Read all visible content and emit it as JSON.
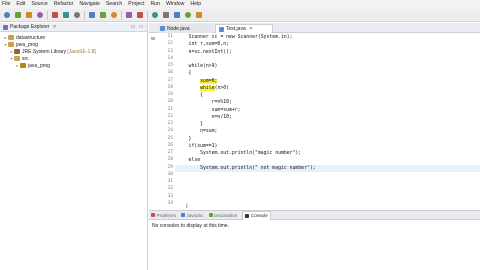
{
  "menubar": {
    "items": [
      {
        "label": "File"
      },
      {
        "label": "Edit"
      },
      {
        "label": "Source"
      },
      {
        "label": "Refactor"
      },
      {
        "label": "Navigate"
      },
      {
        "label": "Search"
      },
      {
        "label": "Project"
      },
      {
        "label": "Run"
      },
      {
        "label": "Window"
      },
      {
        "label": "Help"
      }
    ]
  },
  "toolbar": {
    "icons": [
      "new-file",
      "save",
      "save-all",
      "print",
      "separator",
      "debug",
      "run",
      "external-tools",
      "separator",
      "new-java-project",
      "new-package",
      "new-class",
      "separator",
      "open-type",
      "search",
      "separator",
      "toggle-mark",
      "next-annotation",
      "prev-annotation",
      "back",
      "forward"
    ]
  },
  "explorer": {
    "title": "Package Explorer",
    "tree": [
      {
        "label": "datastructure",
        "suffix": "",
        "icon": "project-icon",
        "indent": 0,
        "expanded": false
      },
      {
        "label": "java_prog",
        "suffix": "",
        "icon": "project-icon",
        "indent": 0,
        "expanded": true
      },
      {
        "label": "JRE System Library",
        "suffix": "[JavaSE-1.8]",
        "icon": "library-icon",
        "indent": 1,
        "expanded": false
      },
      {
        "label": "src",
        "suffix": "",
        "icon": "source-folder-icon",
        "indent": 1,
        "expanded": true
      },
      {
        "label": "java_prog",
        "suffix": "",
        "icon": "package-icon",
        "indent": 2,
        "expanded": false
      }
    ]
  },
  "editor": {
    "tabs": [
      {
        "label": "Node.java",
        "active": false
      },
      {
        "label": "Test.java",
        "active": true
      }
    ],
    "lines": [
      {
        "no": "11",
        "segments": [
          {
            "text": "    Scanner sc = new Scanner(System.in);",
            "hl": false
          }
        ]
      },
      {
        "no": "12",
        "segments": [
          {
            "text": "    int r,sum=0,n;",
            "hl": false
          }
        ]
      },
      {
        "no": "13",
        "segments": [
          {
            "text": "    n=sc.nextInt();",
            "hl": false
          }
        ]
      },
      {
        "no": "14",
        "segments": [
          {
            "text": "",
            "hl": false
          }
        ]
      },
      {
        "no": "15",
        "segments": [
          {
            "text": "    while(n>9)",
            "hl": false
          }
        ]
      },
      {
        "no": "16",
        "segments": [
          {
            "text": "    {",
            "hl": false
          }
        ]
      },
      {
        "no": "17",
        "segments": [
          {
            "text": "        ",
            "hl": false
          },
          {
            "text": "sum=0;",
            "hl": true
          }
        ]
      },
      {
        "no": "18",
        "segments": [
          {
            "text": "        ",
            "hl": false
          },
          {
            "text": "while",
            "hl": true
          },
          {
            "text": "(n>0)",
            "hl": false
          }
        ]
      },
      {
        "no": "19",
        "segments": [
          {
            "text": "        {",
            "hl": false
          }
        ]
      },
      {
        "no": "20",
        "segments": [
          {
            "text": "            r=n%10;",
            "hl": false
          }
        ]
      },
      {
        "no": "21",
        "segments": [
          {
            "text": "            sum=sum+r;",
            "hl": false
          }
        ]
      },
      {
        "no": "22",
        "segments": [
          {
            "text": "            n=n/10;",
            "hl": false
          }
        ]
      },
      {
        "no": "23",
        "segments": [
          {
            "text": "        }",
            "hl": false
          }
        ]
      },
      {
        "no": "24",
        "segments": [
          {
            "text": "        n=sum;",
            "hl": false
          }
        ]
      },
      {
        "no": "25",
        "segments": [
          {
            "text": "    }",
            "hl": false
          }
        ]
      },
      {
        "no": "26",
        "segments": [
          {
            "text": "    if(sum==1)",
            "hl": false
          }
        ]
      },
      {
        "no": "27",
        "segments": [
          {
            "text": "        System.out.println(\"magic number\");",
            "hl": false
          }
        ]
      },
      {
        "no": "28",
        "segments": [
          {
            "text": "    else",
            "hl": false
          }
        ]
      },
      {
        "no": "29",
        "segments": [
          {
            "text": "        System.out.println(\" not magic number\");",
            "hl": false
          }
        ]
      },
      {
        "no": "30",
        "segments": [
          {
            "text": "",
            "hl": false
          }
        ]
      },
      {
        "no": "31",
        "segments": [
          {
            "text": "",
            "hl": false
          }
        ]
      },
      {
        "no": "32",
        "segments": [
          {
            "text": "",
            "hl": false
          }
        ]
      },
      {
        "no": "33",
        "segments": [
          {
            "text": "",
            "hl": false
          }
        ]
      },
      {
        "no": "34",
        "segments": [
          {
            "text": "",
            "hl": false
          }
        ]
      }
    ],
    "current_line_no": "29"
  },
  "bottom": {
    "tabs": [
      {
        "label": "Problems",
        "icon": "problems-icon",
        "active": false
      },
      {
        "label": "Javadoc",
        "icon": "javadoc-icon",
        "active": false
      },
      {
        "label": "Declaration",
        "icon": "declaration-icon",
        "active": false
      },
      {
        "label": "Console",
        "icon": "console-icon",
        "active": true
      }
    ],
    "console_message": "No consoles to display at this time."
  },
  "colors": {
    "highlight": "#f9f23a",
    "current_line": "#e8f1fb",
    "project_icon": "#c9a24a",
    "library_icon": "#8b6a3a",
    "package_icon": "#b8860b"
  }
}
